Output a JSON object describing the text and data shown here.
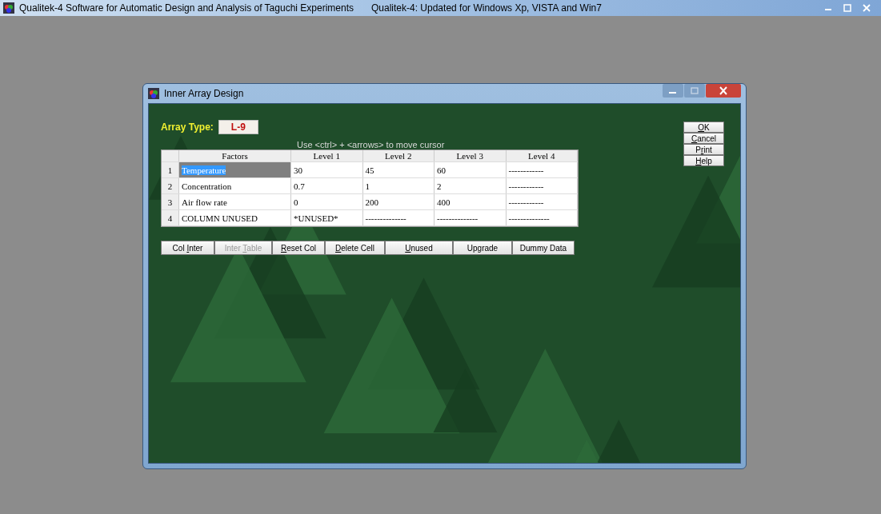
{
  "window": {
    "title": "Qualitek-4 Software for Automatic Design and Analysis of Taguchi Experiments",
    "subtitle": "Qualitek-4: Updated for Windows Xp, VISTA and Win7"
  },
  "dialog": {
    "title": "Inner Array Design",
    "array_type": {
      "label": "Array Type:",
      "value": "L-9"
    },
    "hint": "Use <ctrl> + <arrows> to move cursor",
    "side_buttons": [
      {
        "access_key": "O",
        "after": "K"
      },
      {
        "access_key": "C",
        "after": "ancel"
      },
      {
        "before": "P",
        "access_key": "r",
        "after": "int"
      },
      {
        "access_key": "H",
        "after": "elp"
      }
    ],
    "table": {
      "columns": [
        "Factors",
        "Level 1",
        "Level 2",
        "Level 3",
        "Level 4"
      ],
      "rows": [
        {
          "number": "1",
          "factor": "Temperature",
          "selected": true,
          "levels": [
            "30",
            "45",
            "60",
            "------------"
          ]
        },
        {
          "number": "2",
          "factor": "Concentration",
          "selected": false,
          "levels": [
            "0.7",
            "1",
            "2",
            "------------"
          ]
        },
        {
          "number": "3",
          "factor": "Air flow rate",
          "selected": false,
          "levels": [
            "0",
            "200",
            "400",
            "------------"
          ]
        },
        {
          "number": "4",
          "factor": "COLUMN UNUSED",
          "selected": false,
          "levels": [
            "*UNUSED*",
            "--------------",
            "--------------",
            "--------------"
          ]
        }
      ]
    },
    "buttons": [
      {
        "before": "Col ",
        "access_key": "I",
        "after": "nter",
        "disabled": false
      },
      {
        "before": "Inter ",
        "access_key": "T",
        "after": "able",
        "disabled": true
      },
      {
        "access_key": "R",
        "after": "eset Col",
        "disabled": false
      },
      {
        "access_key": "D",
        "after": "elete Cell",
        "disabled": false
      },
      {
        "access_key": "U",
        "after": "nused",
        "disabled": false
      },
      {
        "before": "Upgrade",
        "disabled": false
      },
      {
        "before": "Dummy Data",
        "disabled": false
      }
    ]
  }
}
